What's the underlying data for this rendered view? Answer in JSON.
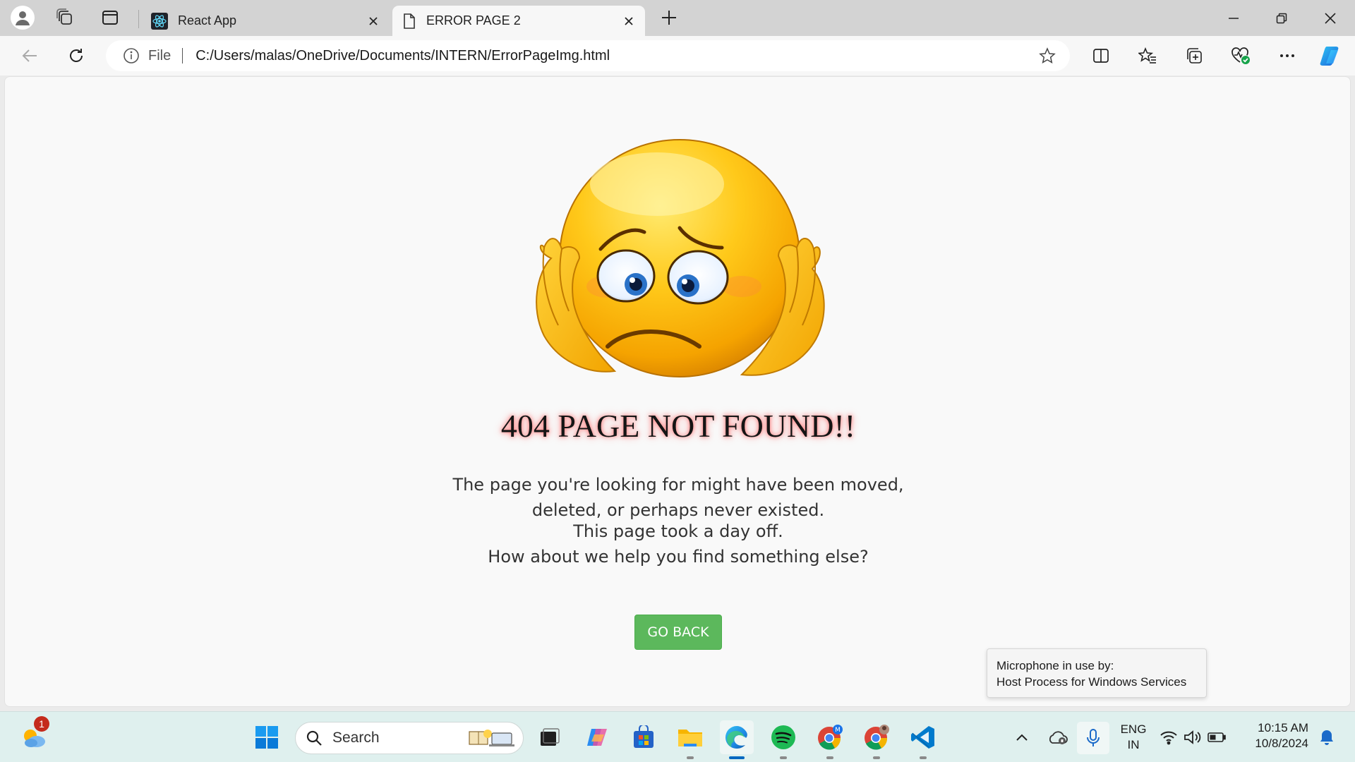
{
  "browser": {
    "tabs": [
      {
        "title": "React App",
        "icon": "react-icon"
      },
      {
        "title": "ERROR PAGE 2",
        "icon": "page-icon"
      }
    ],
    "address": {
      "scheme_label": "File",
      "url": "C:/Users/malas/OneDrive/Documents/INTERN/ErrorPageImg.html"
    }
  },
  "page": {
    "emoji": "sad-face-emoji",
    "title": "404 PAGE NOT FOUND!!",
    "message1_line1": "The page you're looking for might have been moved,",
    "message1_line2": "deleted, or perhaps never existed.",
    "message2_line1": "This page took a day off.",
    "message2_line2": "How about we help you find something else?",
    "button_label": "GO BACK",
    "button_color": "#5cb85c"
  },
  "toast": {
    "line1": "Microphone in use by:",
    "line2": "Host Process for Windows Services"
  },
  "taskbar": {
    "weather_badge": "1",
    "search_label": "Search",
    "language_line1": "ENG",
    "language_line2": "IN",
    "time": "10:15 AM",
    "date": "10/8/2024"
  }
}
